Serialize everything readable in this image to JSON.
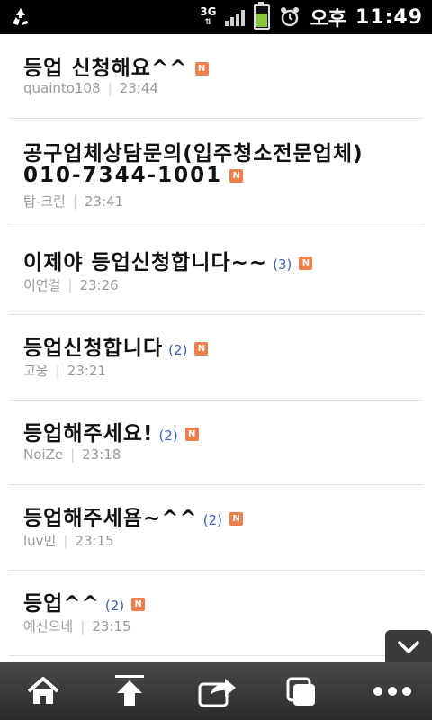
{
  "status_bar": {
    "network": "3G",
    "ampm": "오후",
    "time": "11:49"
  },
  "posts": [
    {
      "title": "등업 신청해요^^",
      "count": "",
      "author": "quainto108",
      "time": "23:44"
    },
    {
      "title": "공구업체상담문의(입주청소전문업체)",
      "title_line2": "010-7344-1001",
      "count": "",
      "author": "탑-크린",
      "time": "23:41"
    },
    {
      "title": "이제야 등업신청합니다~~",
      "count": "(3)",
      "author": "이연걸",
      "time": "23:26"
    },
    {
      "title": "등업신청합니다",
      "count": "(2)",
      "author": "고웅",
      "time": "23:21"
    },
    {
      "title": "등업해주세요!",
      "count": "(2)",
      "author": "NoiZe",
      "time": "23:18"
    },
    {
      "title": "등업해주세욤~^^",
      "count": "(2)",
      "author": "luv민",
      "time": "23:15"
    },
    {
      "title": "등업^^",
      "count": "(2)",
      "author": "예신으네",
      "time": "23:15"
    }
  ],
  "badge_label": "N",
  "toolbar": {
    "home": "home-icon",
    "top": "scroll-to-top-icon",
    "share": "share-icon",
    "windows": "windows-icon",
    "more": "more-icon"
  }
}
